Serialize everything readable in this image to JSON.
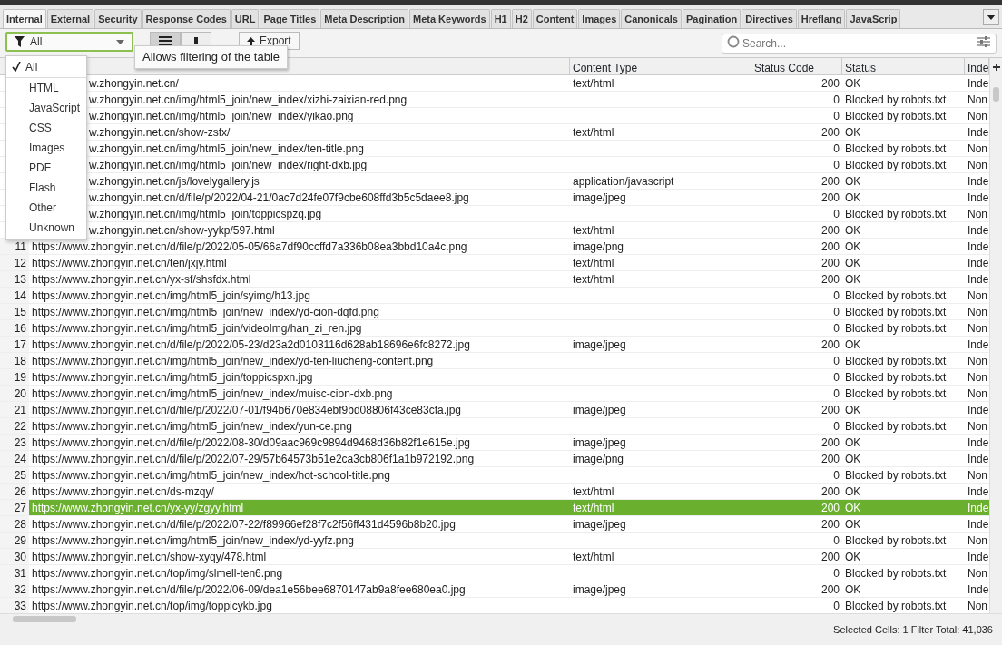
{
  "tabs": [
    {
      "label": "Internal",
      "selected": true
    },
    {
      "label": "External",
      "selected": false
    },
    {
      "label": "Security",
      "selected": false
    },
    {
      "label": "Response Codes",
      "selected": false
    },
    {
      "label": "URL",
      "selected": false
    },
    {
      "label": "Page Titles",
      "selected": false
    },
    {
      "label": "Meta Description",
      "selected": false
    },
    {
      "label": "Meta Keywords",
      "selected": false
    },
    {
      "label": "H1",
      "selected": false
    },
    {
      "label": "H2",
      "selected": false
    },
    {
      "label": "Content",
      "selected": false
    },
    {
      "label": "Images",
      "selected": false
    },
    {
      "label": "Canonicals",
      "selected": false
    },
    {
      "label": "Pagination",
      "selected": false
    },
    {
      "label": "Directives",
      "selected": false
    },
    {
      "label": "Hreflang",
      "selected": false
    },
    {
      "label": "JavaScrip",
      "selected": false
    }
  ],
  "toolbar": {
    "filter": {
      "value": "All"
    },
    "views": [
      {
        "kind": "list",
        "selected": true
      },
      {
        "kind": "tree",
        "selected": false
      }
    ],
    "export_label": "Export",
    "tooltip": "Allows filtering of the table",
    "search": {
      "placeholder": "Search..."
    }
  },
  "filter_menu": [
    {
      "label": "All",
      "selected": true
    },
    {
      "label": "HTML",
      "selected": false
    },
    {
      "label": "JavaScript",
      "selected": false
    },
    {
      "label": "CSS",
      "selected": false
    },
    {
      "label": "Images",
      "selected": false
    },
    {
      "label": "PDF",
      "selected": false
    },
    {
      "label": "Flash",
      "selected": false
    },
    {
      "label": "Other",
      "selected": false
    },
    {
      "label": "Unknown",
      "selected": false
    }
  ],
  "table": {
    "columns": [
      "Content Type",
      "Status Code",
      "Status",
      "Inde"
    ],
    "rows": [
      {
        "address": "w.zhongyin.net.cn/",
        "content_type": "text/html",
        "status_code": "200",
        "status": "OK",
        "column_6": "Inde",
        "selected": false
      },
      {
        "address": "w.zhongyin.net.cn/img/html5_join/new_index/xizhi-zaixian-red.png",
        "status_code": "0",
        "status": "Blocked by robots.txt",
        "column_6": "Non",
        "selected": false
      },
      {
        "address": "w.zhongyin.net.cn/img/html5_join/new_index/yikao.png",
        "status_code": "0",
        "status": "Blocked by robots.txt",
        "column_6": "Non",
        "selected": false
      },
      {
        "address": "w.zhongyin.net.cn/show-zsfx/",
        "content_type": "text/html",
        "status_code": "200",
        "status": "OK",
        "column_6": "Inde",
        "selected": false
      },
      {
        "address": "w.zhongyin.net.cn/img/html5_join/new_index/ten-title.png",
        "status_code": "0",
        "status": "Blocked by robots.txt",
        "column_6": "Non",
        "selected": false
      },
      {
        "address": "w.zhongyin.net.cn/img/html5_join/new_index/right-dxb.jpg",
        "status_code": "0",
        "status": "Blocked by robots.txt",
        "column_6": "Non",
        "selected": false
      },
      {
        "address": "w.zhongyin.net.cn/js/lovelygallery.js",
        "content_type": "application/javascript",
        "status_code": "200",
        "status": "OK",
        "column_6": "Inde",
        "selected": false
      },
      {
        "address": "w.zhongyin.net.cn/d/file/p/2022/04-21/0ac7d24fe07f9cbe608ffd3b5c5daee8.jpg",
        "content_type": "image/jpeg",
        "status_code": "200",
        "status": "OK",
        "column_6": "Inde",
        "selected": false
      },
      {
        "address": "w.zhongyin.net.cn/img/html5_join/toppicspzq.jpg",
        "status_code": "0",
        "status": "Blocked by robots.txt",
        "column_6": "Non",
        "selected": false
      },
      {
        "address": "w.zhongyin.net.cn/show-yykp/597.html",
        "content_type": "text/html",
        "status_code": "200",
        "status": "OK",
        "column_6": "Inde",
        "selected": false
      },
      {
        "number": "11",
        "address": "https://www.zhongyin.net.cn/d/file/p/2022/05-05/66a7df90ccffd7a336b08ea3bbd10a4c.png",
        "content_type": "image/png",
        "status_code": "200",
        "status": "OK",
        "column_6": "Inde",
        "selected": false
      },
      {
        "number": "12",
        "address": "https://www.zhongyin.net.cn/ten/jxjy.html",
        "content_type": "text/html",
        "status_code": "200",
        "status": "OK",
        "column_6": "Inde",
        "selected": false
      },
      {
        "number": "13",
        "address": "https://www.zhongyin.net.cn/yx-sf/shsfdx.html",
        "content_type": "text/html",
        "status_code": "200",
        "status": "OK",
        "column_6": "Inde",
        "selected": false
      },
      {
        "number": "14",
        "address": "https://www.zhongyin.net.cn/img/html5_join/syimg/h13.jpg",
        "status_code": "0",
        "status": "Blocked by robots.txt",
        "column_6": "Non",
        "selected": false
      },
      {
        "number": "15",
        "address": "https://www.zhongyin.net.cn/img/html5_join/new_index/yd-cion-dqfd.png",
        "status_code": "0",
        "status": "Blocked by robots.txt",
        "column_6": "Non",
        "selected": false
      },
      {
        "number": "16",
        "address": "https://www.zhongyin.net.cn/img/html5_join/videoImg/han_zi_ren.jpg",
        "status_code": "0",
        "status": "Blocked by robots.txt",
        "column_6": "Non",
        "selected": false
      },
      {
        "number": "17",
        "address": "https://www.zhongyin.net.cn/d/file/p/2022/05-23/d23a2d0103116d628ab18696e6fc8272.jpg",
        "content_type": "image/jpeg",
        "status_code": "200",
        "status": "OK",
        "column_6": "Inde",
        "selected": false
      },
      {
        "number": "18",
        "address": "https://www.zhongyin.net.cn/img/html5_join/new_index/yd-ten-liucheng-content.png",
        "status_code": "0",
        "status": "Blocked by robots.txt",
        "column_6": "Non",
        "selected": false
      },
      {
        "number": "19",
        "address": "https://www.zhongyin.net.cn/img/html5_join/toppicspxn.jpg",
        "status_code": "0",
        "status": "Blocked by robots.txt",
        "column_6": "Non",
        "selected": false
      },
      {
        "number": "20",
        "address": "https://www.zhongyin.net.cn/img/html5_join/new_index/muisc-cion-dxb.png",
        "status_code": "0",
        "status": "Blocked by robots.txt",
        "column_6": "Non",
        "selected": false
      },
      {
        "number": "21",
        "address": "https://www.zhongyin.net.cn/d/file/p/2022/07-01/f94b670e834ebf9bd08806f43ce83cfa.jpg",
        "content_type": "image/jpeg",
        "status_code": "200",
        "status": "OK",
        "column_6": "Inde",
        "selected": false
      },
      {
        "number": "22",
        "address": "https://www.zhongyin.net.cn/img/html5_join/new_index/yun-ce.png",
        "status_code": "0",
        "status": "Blocked by robots.txt",
        "column_6": "Non",
        "selected": false
      },
      {
        "number": "23",
        "address": "https://www.zhongyin.net.cn/d/file/p/2022/08-30/d09aac969c9894d9468d36b82f1e615e.jpg",
        "content_type": "image/jpeg",
        "status_code": "200",
        "status": "OK",
        "column_6": "Inde",
        "selected": false
      },
      {
        "number": "24",
        "address": "https://www.zhongyin.net.cn/d/file/p/2022/07-29/57b64573b51e2ca3cb806f1a1b972192.png",
        "content_type": "image/png",
        "status_code": "200",
        "status": "OK",
        "column_6": "Inde",
        "selected": false
      },
      {
        "number": "25",
        "address": "https://www.zhongyin.net.cn/img/html5_join/new_index/hot-school-title.png",
        "status_code": "0",
        "status": "Blocked by robots.txt",
        "column_6": "Non",
        "selected": false
      },
      {
        "number": "26",
        "address": "https://www.zhongyin.net.cn/ds-mzqy/",
        "content_type": "text/html",
        "status_code": "200",
        "status": "OK",
        "column_6": "Inde",
        "selected": false
      },
      {
        "number": "27",
        "address": "https://www.zhongyin.net.cn/yx-yy/zgyy.html",
        "content_type": "text/html",
        "status_code": "200",
        "status": "OK",
        "column_6": "Inde",
        "selected": true
      },
      {
        "number": "28",
        "address": "https://www.zhongyin.net.cn/d/file/p/2022/07-22/f89966ef28f7c2f56ff431d4596b8b20.jpg",
        "content_type": "image/jpeg",
        "status_code": "200",
        "status": "OK",
        "column_6": "Inde",
        "selected": false
      },
      {
        "number": "29",
        "address": "https://www.zhongyin.net.cn/img/html5_join/new_index/yd-yyfz.png",
        "status_code": "0",
        "status": "Blocked by robots.txt",
        "column_6": "Non",
        "selected": false
      },
      {
        "number": "30",
        "address": "https://www.zhongyin.net.cn/show-xyqy/478.html",
        "content_type": "text/html",
        "status_code": "200",
        "status": "OK",
        "column_6": "Inde",
        "selected": false
      },
      {
        "number": "31",
        "address": "https://www.zhongyin.net.cn/top/img/slmell-ten6.png",
        "status_code": "0",
        "status": "Blocked by robots.txt",
        "column_6": "Non",
        "selected": false
      },
      {
        "number": "32",
        "address": "https://www.zhongyin.net.cn/d/file/p/2022/06-09/dea1e56bee6870147ab9a8fee680ea0.jpg",
        "content_type": "image/jpeg",
        "status_code": "200",
        "status": "OK",
        "column_6": "Inde",
        "selected": false
      },
      {
        "number": "33",
        "address": "https://www.zhongyin.net.cn/top/img/toppicykb.jpg",
        "status_code": "0",
        "status": "Blocked by robots.txt",
        "column_6": "Non",
        "selected": false
      }
    ]
  },
  "status_bar": "Selected Cells: 1  Filter Total: 41,036"
}
